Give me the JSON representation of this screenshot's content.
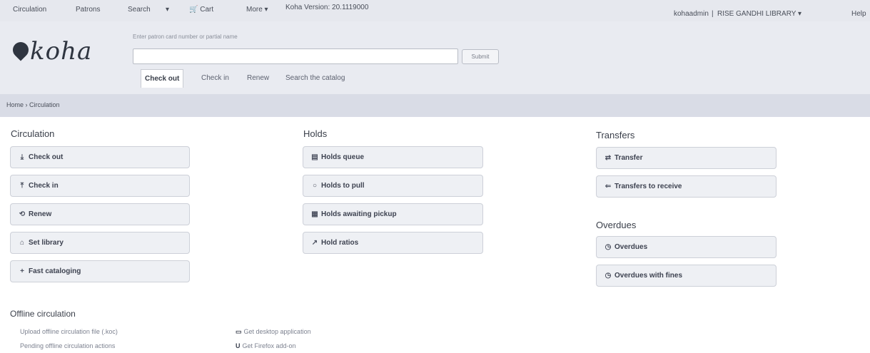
{
  "topnav": {
    "circulation": "Circulation",
    "patrons": "Patrons",
    "search": "Search",
    "search_caret": "▾",
    "cart_icon": "cart-icon",
    "cart": "Cart",
    "more": "More ▾",
    "version": "Koha Version: 20.1119000",
    "user": "kohaadmin",
    "separator": "|",
    "library": "RISE GANDHI LIBRARY ▾",
    "help": "Help"
  },
  "header": {
    "logo": "koha",
    "search_hint": "Enter patron card number or partial name",
    "search_value": "",
    "submit": "Submit",
    "tabs": [
      "Check out",
      "Check in",
      "Renew",
      "Search the catalog"
    ]
  },
  "breadcrumb": {
    "home": "Home",
    "sep": "›",
    "current": "Circulation"
  },
  "circulation": {
    "title": "Circulation",
    "items": [
      {
        "icon": "check-out-icon",
        "label": "Check out"
      },
      {
        "icon": "check-in-icon",
        "label": "Check in"
      },
      {
        "icon": "renew-icon",
        "label": "Renew"
      },
      {
        "icon": "set-library-icon",
        "label": "Set library"
      },
      {
        "icon": "plus-icon",
        "label": "Fast cataloging"
      }
    ]
  },
  "holds": {
    "title": "Holds",
    "items": [
      {
        "icon": "holds-queue-icon",
        "label": "Holds queue"
      },
      {
        "icon": "holds-to-pull-icon",
        "label": "Holds to pull"
      },
      {
        "icon": "calendar-icon",
        "label": "Holds awaiting pickup"
      },
      {
        "icon": "chart-icon",
        "label": "Hold ratios"
      }
    ]
  },
  "transfers": {
    "title": "Transfers",
    "items": [
      {
        "icon": "transfer-icon",
        "label": "Transfer"
      },
      {
        "icon": "receive-icon",
        "label": "Transfers to receive"
      }
    ]
  },
  "overdues": {
    "title": "Overdues",
    "items": [
      {
        "icon": "clock-icon",
        "label": "Overdues"
      },
      {
        "icon": "clock-icon",
        "label": "Overdues with fines"
      }
    ]
  },
  "offline": {
    "title": "Offline circulation",
    "links": [
      "Upload offline circulation file (.koc)",
      "Pending offline circulation actions",
      "Get desktop application",
      "Get Firefox add-on"
    ]
  }
}
